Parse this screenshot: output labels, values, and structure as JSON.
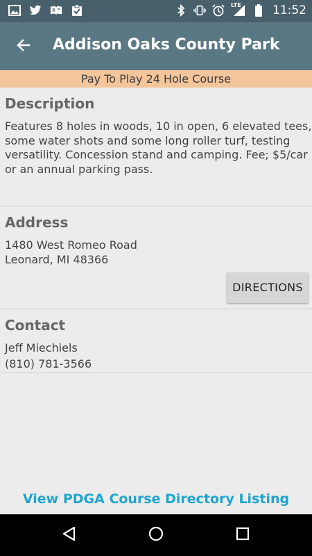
{
  "status_bar": {
    "time": "11:52",
    "network_label": "LTE",
    "left_icons": [
      "gallery-icon",
      "twitter-icon",
      "news-icon",
      "clipboard-check-icon"
    ],
    "right_icons": [
      "bluetooth-icon",
      "vibrate-icon",
      "alarm-icon",
      "lte-signal-icon",
      "battery-icon"
    ]
  },
  "app_bar": {
    "title": "Addison Oaks County Park",
    "back_icon": "arrow-left-icon"
  },
  "banner": {
    "text": "Pay To Play 24 Hole Course"
  },
  "description": {
    "title": "Description",
    "text": "Features 8 holes in woods, 10 in open, 6 elevated tees, some water shots and some long roller turf, testing versatility. Concession stand and camping. Fee; $5/car or an annual parking pass."
  },
  "address": {
    "title": "Address",
    "line1": "1480 West Romeo Road",
    "line2": "Leonard, MI 48366",
    "directions_label": "DIRECTIONS"
  },
  "contact": {
    "title": "Contact",
    "name": "Jeff Miechiels",
    "phone": "(810) 781-3566"
  },
  "footer_link": "View PDGA Course Directory Listing",
  "nav_bar": {
    "icons": [
      "back-triangle-icon",
      "home-circle-icon",
      "recents-square-icon"
    ]
  },
  "colors": {
    "status_bar": "#48606c",
    "app_bar": "#5a7884",
    "banner": "#f3c59b",
    "link": "#1ea5cf",
    "background": "#ececec"
  }
}
